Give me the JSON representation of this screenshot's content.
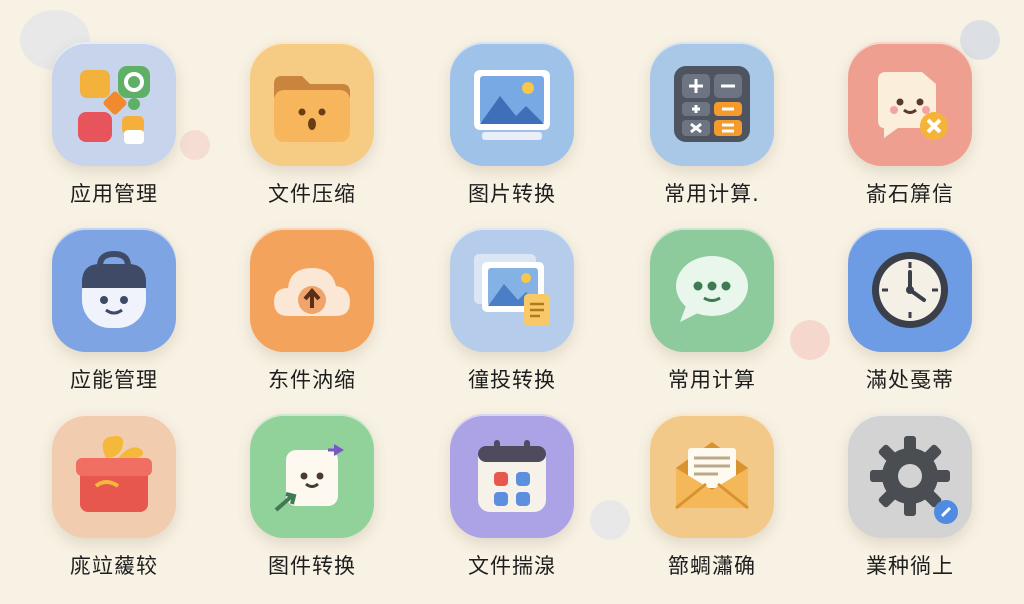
{
  "apps": [
    {
      "label": "应用管理",
      "icon": "app-grid-icon",
      "color": "#c8d3ec"
    },
    {
      "label": "文件压缩",
      "icon": "folder-icon",
      "color": "#f6cb83"
    },
    {
      "label": "图片转换",
      "icon": "image-icon",
      "color": "#9fc2e8"
    },
    {
      "label": "常用计算.",
      "icon": "calculator-icon",
      "color": "#a9c7e6"
    },
    {
      "label": "嵛石箳信",
      "icon": "message-cancel-icon",
      "color": "#ee9f90"
    },
    {
      "label": "应能管理",
      "icon": "smiley-bag-icon",
      "color": "#7ea4e4"
    },
    {
      "label": "东件汭缩",
      "icon": "cloud-upload-icon",
      "color": "#f4a35d"
    },
    {
      "label": "徸投转换",
      "icon": "photo-stack-icon",
      "color": "#b5cdea"
    },
    {
      "label": "常用计算",
      "icon": "chat-bubble-icon",
      "color": "#8dcb9c"
    },
    {
      "label": "滿处戞蒂",
      "icon": "clock-icon",
      "color": "#6d9be4"
    },
    {
      "label": "庣竝藧较",
      "icon": "gift-box-icon",
      "color": "#f1ccaf"
    },
    {
      "label": "图件转换",
      "icon": "cube-character-icon",
      "color": "#90d29a"
    },
    {
      "label": "文件揣湶",
      "icon": "calendar-icon",
      "color": "#aca2e6"
    },
    {
      "label": "篰蜩瀟确",
      "icon": "envelope-icon",
      "color": "#f3c98a"
    },
    {
      "label": "業种徜上",
      "icon": "gear-icon",
      "color": "#d3d3d3"
    }
  ]
}
